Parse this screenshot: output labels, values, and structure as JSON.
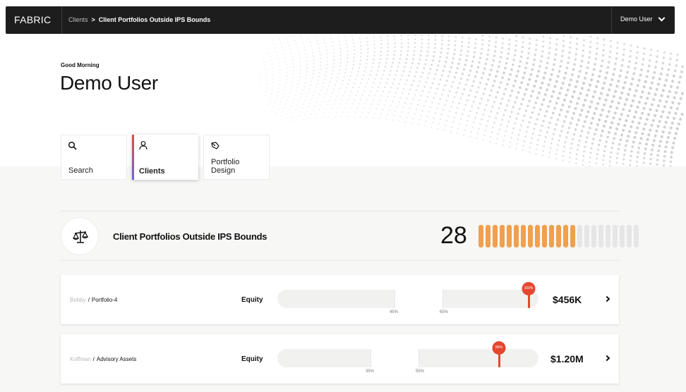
{
  "topbar": {
    "brand": "FABRIC",
    "breadcrumb": [
      "Clients",
      "Client Portfolios Outside IPS Bounds"
    ],
    "breadcrumb_separator": ">",
    "user_menu": "Demo User"
  },
  "greeting": {
    "salutation": "Good Morning",
    "name": "Demo User"
  },
  "nav": [
    {
      "label": "Search",
      "icon": "search-icon",
      "active": false
    },
    {
      "label": "Clients",
      "icon": "user-icon",
      "active": true
    },
    {
      "label": "Portfolio Design",
      "icon": "pen-nib-icon",
      "active": false
    }
  ],
  "summary": {
    "icon": "scales-icon",
    "title": "Client Portfolios Outside IPS Bounds",
    "count": "28",
    "filled_ticks": 14,
    "total_ticks": 23,
    "filled_color": "#f0a04e",
    "empty_color": "#e6e6e6"
  },
  "rows": [
    {
      "client": "Bobby",
      "separator": "/",
      "portfolio": "Portfolio-4",
      "asset_class": "Equity",
      "range_low": "45%",
      "range_high": "65%",
      "current": "100%",
      "value": "$456K"
    },
    {
      "client": "Koffman",
      "separator": "/",
      "portfolio": "Advisory Assets",
      "asset_class": "Equity",
      "range_low": "35%",
      "range_high": "55%",
      "current": "86%",
      "value": "$1.20M"
    }
  ],
  "colors": {
    "topbar": "#1d1d1d",
    "accent_orange": "#f0a04e",
    "marker_red": "#e4472f"
  }
}
